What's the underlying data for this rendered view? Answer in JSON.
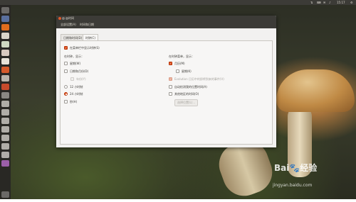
{
  "window": {
    "title": "时间",
    "menu": [
      "全部设置(A)",
      "时间和日期"
    ],
    "tabs": [
      "日期和时间(D)",
      "时钟(C)"
    ],
    "active_tab": 1
  },
  "clock": {
    "show_in_menubar": "在菜单栏中显示时钟(S)",
    "left_heading": "在时钟，显示：",
    "left_items": [
      {
        "label": "星期(W)",
        "kind": "checkbox",
        "checked": false
      },
      {
        "label": "日期和月份(D)",
        "kind": "checkbox",
        "checked": false
      },
      {
        "label": "年份(Y)",
        "kind": "checkbox",
        "checked": false,
        "disabled": true
      },
      {
        "label": "12 小时制",
        "kind": "radio",
        "checked": false
      },
      {
        "label": "24 小时制",
        "kind": "radio",
        "checked": true
      },
      {
        "label": "秒(H)",
        "kind": "checkbox",
        "checked": false
      }
    ],
    "right_heading": "在时钟菜单，显示：",
    "right_items": [
      {
        "label": "月历(M)",
        "kind": "checkbox",
        "checked": true
      },
      {
        "label": "星期(K)",
        "kind": "checkbox",
        "checked": false
      },
      {
        "label": "Evolution 日历中的即将到来的事件(V)",
        "kind": "checkbox",
        "checked": true,
        "disabled": true
      },
      {
        "label": "自动检测我的位置时间(A)",
        "kind": "checkbox",
        "checked": false
      },
      {
        "label": "其他地区的时间(O)",
        "kind": "checkbox",
        "checked": false
      }
    ],
    "locations_button": "选择位置(L)..."
  },
  "topbar": {
    "clock": "15:17"
  },
  "watermark": {
    "brand": "Bai🐾经验",
    "url": "jingyan.baidu.com"
  },
  "colors": {
    "accent": "#dd4814",
    "panel": "#3c3b37",
    "window_bg": "#f2f1f0"
  }
}
